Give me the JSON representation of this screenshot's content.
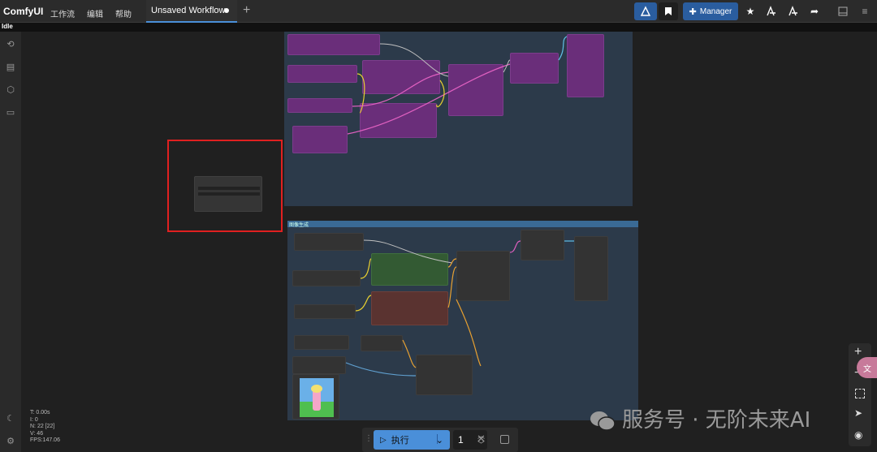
{
  "app": {
    "name": "ComfyUI"
  },
  "menu": [
    "工作流",
    "编辑",
    "帮助"
  ],
  "tab": {
    "title": "Unsaved Workflow"
  },
  "toolbar": {
    "manager_label": "Manager"
  },
  "status": {
    "text": "Idle"
  },
  "stats": [
    "T: 0.00s",
    "I: 0",
    "N: 22 [22]",
    "V: 46",
    "FPS:147.06"
  ],
  "run": {
    "label": "执行",
    "count": "1"
  },
  "group_title": "图像生成",
  "watermark": "服务号 · 无阶未来AI",
  "colors": {
    "accent": "#4a8fd9",
    "purple_node": "#6a2e7a",
    "group_bg": "#2c3a4a",
    "selection": "#e02020"
  },
  "icons": [
    "history-icon",
    "queue-icon",
    "model-library-icon",
    "workflows-icon",
    "theme-icon",
    "settings-icon"
  ]
}
